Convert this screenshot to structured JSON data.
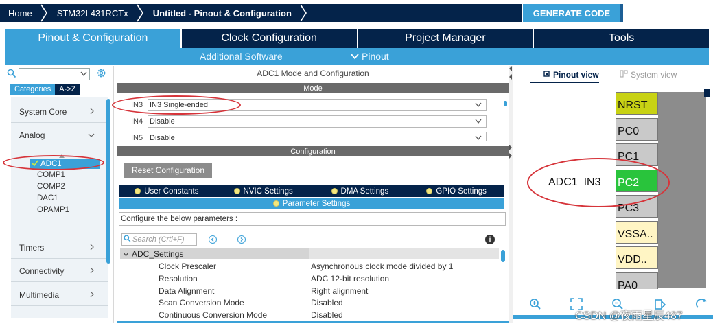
{
  "breadcrumb": {
    "items": [
      "Home",
      "STM32L431RCTx",
      "Untitled - Pinout & Configuration"
    ]
  },
  "generate_button": "GENERATE CODE",
  "main_tabs": [
    {
      "label": "Pinout & Configuration",
      "active": true
    },
    {
      "label": "Clock Configuration",
      "active": false
    },
    {
      "label": "Project Manager",
      "active": false
    },
    {
      "label": "Tools",
      "active": false
    }
  ],
  "sub_tabs": {
    "additional_software": "Additional Software",
    "pinout": "Pinout"
  },
  "left_panel": {
    "category_tabs": [
      "Categories",
      "A->Z"
    ],
    "categories": [
      "System Core",
      "Analog",
      "Timers",
      "Connectivity",
      "Multimedia"
    ],
    "analog_items": [
      "ADC1",
      "COMP1",
      "COMP2",
      "DAC1",
      "OPAMP1"
    ],
    "selected_item": "ADC1"
  },
  "center": {
    "title": "ADC1 Mode and Configuration",
    "mode_header": "Mode",
    "mode_rows": [
      {
        "label": "IN3",
        "value": "IN3 Single-ended"
      },
      {
        "label": "IN4",
        "value": "Disable"
      },
      {
        "label": "IN5",
        "value": "Disable"
      }
    ],
    "config_header": "Configuration",
    "reset_button": "Reset Configuration",
    "settings_tabs": [
      "User Constants",
      "NVIC Settings",
      "DMA Settings",
      "GPIO Settings"
    ],
    "parameter_tab": "Parameter Settings",
    "configure_text": "Configure the below parameters :",
    "search_placeholder": "Search (Crtl+F)",
    "group": "ADC_Settings",
    "params": [
      {
        "name": "Clock Prescaler",
        "value": "Asynchronous clock mode divided by 1"
      },
      {
        "name": "Resolution",
        "value": "ADC 12-bit resolution"
      },
      {
        "name": "Data Alignment",
        "value": "Right alignment"
      },
      {
        "name": "Scan Conversion Mode",
        "value": "Disabled"
      },
      {
        "name": "Continuous Conversion Mode",
        "value": "Disabled"
      }
    ]
  },
  "right_panel": {
    "pinout_view": "Pinout view",
    "system_view": "System view",
    "pins": [
      {
        "label": "NRST",
        "color": "#c8d214"
      },
      {
        "label": "PC0",
        "color": "#c9c9c9"
      },
      {
        "label": "PC1",
        "color": "#c9c9c9"
      },
      {
        "label": "PC2",
        "color": "#29c43c"
      },
      {
        "label": "PC3",
        "color": "#c9c9c9"
      },
      {
        "label": "VSSA..",
        "color": "#fff5c4"
      },
      {
        "label": "VDD..",
        "color": "#fff5c4"
      },
      {
        "label": "PA0",
        "color": "#c9c9c9"
      }
    ],
    "signal_label": "ADC1_IN3"
  },
  "watermark": "CSDN @夜雨星辰487",
  "colors": {
    "navy": "#04234a",
    "accent": "#3aa1d8",
    "annotation_red": "#d6343a",
    "pin_green": "#29c43c"
  }
}
